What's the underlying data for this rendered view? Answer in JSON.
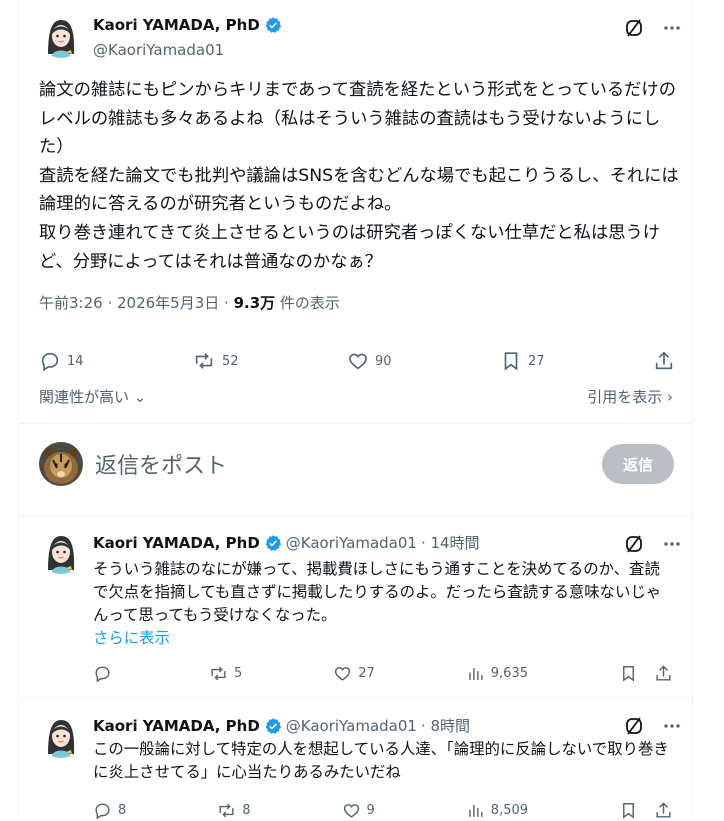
{
  "main": {
    "author_name": "Kaori YAMADA, PhD",
    "author_handle": "@KaoriYamada01",
    "text": "論文の雑誌にもピンからキリまであって査読を経たという形式をとっているだけのレベルの雑誌も多々あるよね（私はそういう雑誌の査読はもう受けないようにした）\n査読を経た論文でも批判や議論はSNSを含むどんな場でも起こりうるし、それには論理的に答えるのが研究者というものだよね。\n取り巻き連れてきて炎上させるというのは研究者っぽくない仕草だと私は思うけど、分野によってはそれは普通なのかなぁ？",
    "time": "午前3:26 · 2026年5月3日 · ",
    "views_count": "9.3万",
    "views_label": " 件の表示",
    "replies": "14",
    "reposts": "52",
    "likes": "90",
    "bookmarks": "27"
  },
  "sort": {
    "relevance_label": "関連性が高い",
    "quotes_label": "引用を表示"
  },
  "reply_box": {
    "placeholder": "返信をポスト",
    "button_label": "返信"
  },
  "replies": [
    {
      "name": "Kaori YAMADA, PhD",
      "handle": "@KaoriYamada01",
      "time": " · 14時間",
      "text": "そういう雑誌のなにが嫌って、掲載費ほしさにもう通すことを決めてるのか、査読で欠点を指摘しても直さずに掲載したりするのよ。だったら査読する意味ないじゃんって思ってもう受けなくなった。",
      "more": "さらに表示",
      "replies": "",
      "reposts": "5",
      "likes": "27",
      "views": "9,635"
    },
    {
      "name": "Kaori YAMADA, PhD",
      "handle": "@KaoriYamada01",
      "time": " · 8時間",
      "text": "この一般論に対して特定の人を想起している人達、「論理的に反論しないで取り巻きに炎上させてる」に心当たりあるみたいだね",
      "replies": "8",
      "reposts": "8",
      "likes": "9",
      "views": "8,509"
    }
  ],
  "icons": {
    "verified": "verified-badge-icon",
    "grok": "grok-icon",
    "more": "more-icon",
    "reply": "reply-icon",
    "repost": "repost-icon",
    "like": "like-icon",
    "bookmark": "bookmark-icon",
    "share": "share-icon",
    "views": "views-icon"
  },
  "colors": {
    "verified": "#1d9bf0",
    "link": "#1d9bf0",
    "muted": "#536471",
    "button_disabled": "#b9bfc4"
  }
}
